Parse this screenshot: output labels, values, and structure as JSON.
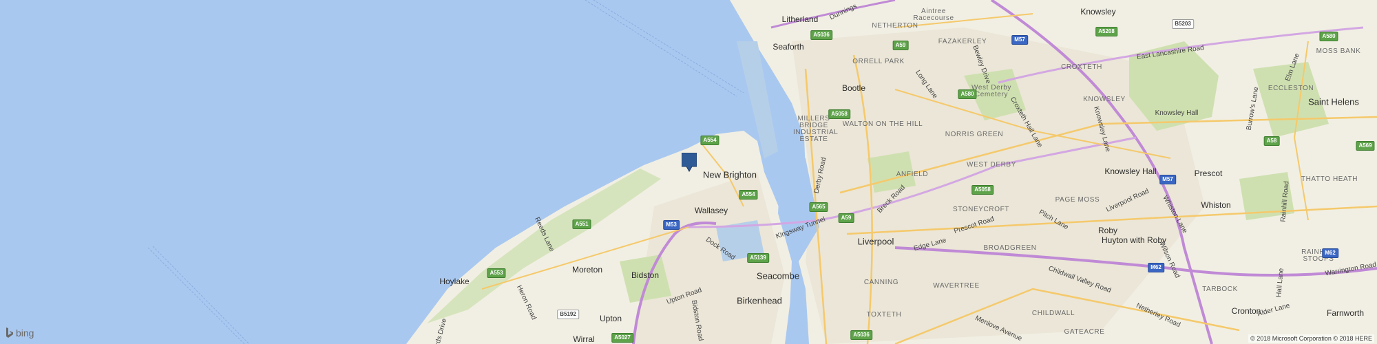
{
  "colors": {
    "water": "#a9c8f0",
    "land": "#f1efe3",
    "urban": "#ebe6d7",
    "park": "#cfe0b0",
    "motorway": "#c08ad6",
    "aroad": "#f5c96b",
    "pin": "#2e5a96"
  },
  "places": {
    "litherland": "Litherland",
    "seaforth": "Seaforth",
    "bootle": "Bootle",
    "new_brighton": "New Brighton",
    "wallasey": "Wallasey",
    "hoylake": "Hoylake",
    "moreton": "Moreton",
    "bidston": "Bidston",
    "upton": "Upton",
    "wirral": "Wirral",
    "seacombe": "Seacombe",
    "birkenhead": "Birkenhead",
    "liverpool": "Liverpool",
    "knowsley": "Knowsley",
    "knowsley_hall": "Knowsley Hall",
    "saint_helens": "Saint Helens",
    "prescot": "Prescot",
    "whiston": "Whiston",
    "roby": "Roby",
    "huyton": "Huyton with Roby",
    "cronton": "Cronton",
    "farnworth": "Farnworth",
    "west_derby_cemetery": "West Derby Cemetery",
    "knowsley_hall_park": "Knowsley Hall"
  },
  "districts": {
    "netherton": "NETHERTON",
    "aintree": "Aintree Racecourse",
    "fazakerley": "FAZAKERLEY",
    "orrell_park": "ORRELL PARK",
    "croxteth": "CROXTETH",
    "moss_bank": "MOSS BANK",
    "eccleston": "ECCLESTON",
    "millers_bridge": "MILLERS BRIDGE INDUSTRIAL ESTATE",
    "walton": "WALTON ON THE HILL",
    "norris_green": "NORRIS GREEN",
    "west_derby": "WEST DERBY",
    "anfield": "ANFIELD",
    "stoneycroft": "STONEYCROFT",
    "page_moss": "PAGE MOSS",
    "broadgreen": "BROADGREEN",
    "knowsley_dist": "KNOWSLEY",
    "thatto_heath": "THATTO HEATH",
    "rainhill_stoops": "RAINHILL STOOPS",
    "canning": "CANNING",
    "wavertree": "WAVERTREE",
    "childwall": "CHILDWALL",
    "toxteth": "TOXTETH",
    "gateacre": "GATEACRE",
    "tarbock": "TARBOCK"
  },
  "roads": {
    "dunnings": "Dunnings",
    "long_lane": "Long Lane",
    "croxteth_hall_lane": "Croxteth Hall Lane",
    "east_lancashire": "East Lancashire Road",
    "bewley": "Bewley Drive",
    "derby_road": "Derby Road",
    "breck_road": "Breck Road",
    "kingsway": "Kingsway Tunnel",
    "dock_road": "Dock Road",
    "reeds_lane": "Reeds Lane",
    "heron_road": "Heron Road",
    "upton_road": "Upton Road",
    "bidston_road": "Bidston Road",
    "prescot_road": "Prescot Road",
    "edge_lane": "Edge Lane",
    "pitch_lane": "Pitch Lane",
    "liverpool_road": "Liverpool Road",
    "knowsley_lane": "Knowsley Lane",
    "whiston_lane": "Whiston Lane",
    "wilson_road": "Wilson Road",
    "childwall_valley": "Childwall Valley Road",
    "menlove": "Menlove Avenue",
    "warrington_road": "Warrington Road",
    "hall_lane": "Hall Lane",
    "alder_lane": "Alder Lane",
    "netherley": "Netherley Road",
    "rainhill_road": "Rainhill Road",
    "burrows_lane": "Burrow's Lane",
    "elm_lane": "Elm Lane",
    "birds_drive": "Birds Drive"
  },
  "shields": {
    "a5036_n": "A5036",
    "a59_n": "A59",
    "m57_n": "M57",
    "a5208": "A5208",
    "b5203": "B5203",
    "a580": "A580",
    "a580b": "A580",
    "a5058_n": "A5058",
    "a554_n": "A554",
    "a554_s": "A554",
    "a565": "A565",
    "a59_c": "A59",
    "a5058_c": "A5058",
    "a58": "A58",
    "a569": "A569",
    "m57_s": "M57",
    "a551": "A551",
    "m53": "M53",
    "a5139": "A5139",
    "a553": "A553",
    "b5192": "B5192",
    "a5027": "A5027",
    "a5036_s": "A5036",
    "m62_a": "M62",
    "m62_b": "M62"
  },
  "branding": {
    "logo_text": "bing",
    "copyright": "© 2018 Microsoft Corporation © 2018 HERE"
  }
}
